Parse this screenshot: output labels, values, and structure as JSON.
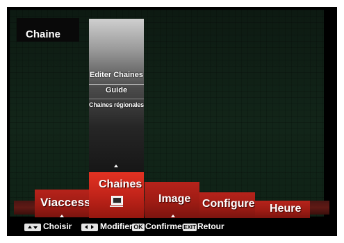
{
  "screen": {
    "title": "Chaine"
  },
  "submenu": {
    "items": [
      {
        "label": "Editer Chaines"
      },
      {
        "label": "Guide"
      },
      {
        "label": "Chaines régionales"
      }
    ]
  },
  "menu": {
    "tabs": [
      {
        "label": "Viaccess"
      },
      {
        "label": "Chaines",
        "selected": true,
        "icon": "tv-icon"
      },
      {
        "label": "Image"
      },
      {
        "label": "Configurer"
      },
      {
        "label": "Heure"
      }
    ]
  },
  "footer": {
    "hints": [
      {
        "label": "Choisir",
        "icon": "up-down-arrows-icon"
      },
      {
        "label": "Modifier",
        "icon": "left-right-arrows-icon"
      },
      {
        "key": "OK",
        "label": "Confirmer"
      },
      {
        "key": "EXIT",
        "label": "Retour"
      }
    ]
  },
  "colors": {
    "accent_red": "#c2241a",
    "selected_red": "#e33222",
    "background": "#0f2216"
  }
}
